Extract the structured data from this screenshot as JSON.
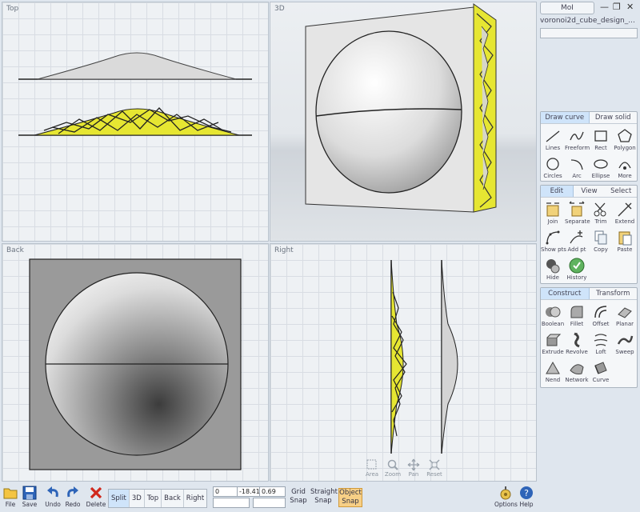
{
  "viewports": {
    "top": {
      "label": "Top"
    },
    "persp": {
      "label": "3D"
    },
    "back": {
      "label": "Back"
    },
    "right": {
      "label": "Right"
    }
  },
  "nav_controls": [
    {
      "label": "Area",
      "icon": "zoom-area-icon"
    },
    {
      "label": "Zoom",
      "icon": "zoom-icon"
    },
    {
      "label": "Pan",
      "icon": "pan-icon"
    },
    {
      "label": "Reset",
      "icon": "reset-icon"
    }
  ],
  "header": {
    "app_button": "MoI",
    "file_name": "voronoi2d_cube_design_...",
    "command_value": ""
  },
  "draw_palette": {
    "tabs": [
      "Draw curve",
      "Draw solid"
    ],
    "tools": [
      {
        "label": "Lines",
        "icon": "lines-icon"
      },
      {
        "label": "Freeform",
        "icon": "freeform-icon"
      },
      {
        "label": "Rect",
        "icon": "rect-icon"
      },
      {
        "label": "Polygon",
        "icon": "polygon-icon"
      },
      {
        "label": "Circles",
        "icon": "circles-icon"
      },
      {
        "label": "Arc",
        "icon": "arc-icon"
      },
      {
        "label": "Ellipse",
        "icon": "ellipse-icon"
      },
      {
        "label": "More",
        "icon": "more-icon"
      }
    ]
  },
  "edit_palette": {
    "tabs": [
      "Edit",
      "View",
      "Select"
    ],
    "tools": [
      {
        "label": "Join",
        "icon": "join-icon"
      },
      {
        "label": "Separate",
        "icon": "separate-icon"
      },
      {
        "label": "Trim",
        "icon": "trim-icon"
      },
      {
        "label": "Extend",
        "icon": "extend-icon"
      },
      {
        "label": "Show pts",
        "icon": "show-points-icon"
      },
      {
        "label": "Add pt",
        "icon": "add-point-icon"
      },
      {
        "label": "Copy",
        "icon": "copy-icon"
      },
      {
        "label": "Paste",
        "icon": "paste-icon"
      },
      {
        "label": "Hide",
        "icon": "hide-icon"
      },
      {
        "label": "History",
        "icon": "history-icon"
      }
    ]
  },
  "construct_palette": {
    "tabs": [
      "Construct",
      "Transform"
    ],
    "tools": [
      {
        "label": "Boolean",
        "icon": "boolean-icon"
      },
      {
        "label": "Fillet",
        "icon": "fillet-icon"
      },
      {
        "label": "Offset",
        "icon": "offset-icon"
      },
      {
        "label": "Planar",
        "icon": "planar-icon"
      },
      {
        "label": "Extrude",
        "icon": "extrude-icon"
      },
      {
        "label": "Revolve",
        "icon": "revolve-icon"
      },
      {
        "label": "Loft",
        "icon": "loft-icon"
      },
      {
        "label": "Sweep",
        "icon": "sweep-icon"
      },
      {
        "label": "Nend",
        "icon": "network-end-icon"
      },
      {
        "label": "Network",
        "icon": "network-icon"
      },
      {
        "label": "Curve",
        "icon": "curve-icon"
      }
    ]
  },
  "bottom_bar": {
    "file_buttons": [
      {
        "label": "File",
        "icon": "folder-icon"
      },
      {
        "label": "Save",
        "icon": "save-icon"
      },
      {
        "label": "Undo",
        "icon": "undo-icon"
      },
      {
        "label": "Redo",
        "icon": "redo-icon"
      },
      {
        "label": "Delete",
        "icon": "delete-icon"
      }
    ],
    "view_buttons": [
      "Split",
      "3D",
      "Top",
      "Back",
      "Right"
    ],
    "active_view": "Split",
    "coords": {
      "x": "0",
      "y": "-18.41",
      "z": "0.69",
      "dist": "",
      "angle": ""
    },
    "snaps": [
      {
        "line1": "Grid",
        "line2": "Snap",
        "active": false
      },
      {
        "line1": "Straight",
        "line2": "Snap",
        "active": false
      },
      {
        "line1": "Object",
        "line2": "Snap",
        "active": true
      }
    ],
    "options_label": "Options",
    "help_label": "Help"
  },
  "colors": {
    "accent_tab": "#cfe4fa",
    "active_snap": "#f7cf86",
    "voronoi_yellow": "#e6e632"
  }
}
